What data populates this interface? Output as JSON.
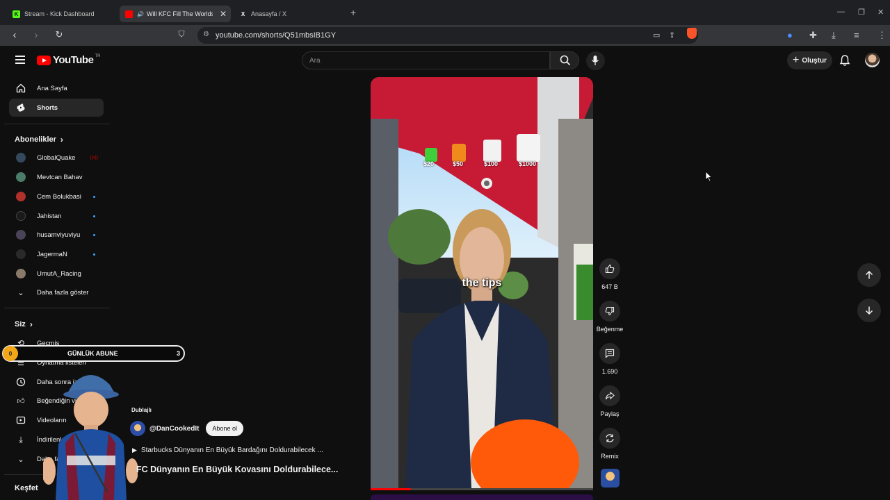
{
  "browser": {
    "tabs": [
      {
        "label": "Stream - Kick Dashboard",
        "active": false
      },
      {
        "label": "Will KFC Fill The Worlds Big",
        "active": true
      },
      {
        "label": "Anasayfa / X",
        "active": false
      }
    ],
    "url": "youtube.com/shorts/Q51mbsIB1GY",
    "colors": {
      "tabbar": "#1f2023",
      "toolbar": "#35363a",
      "kick": "#53fc18"
    }
  },
  "header": {
    "logo_text": "YouTube",
    "country_code": "TR",
    "search_placeholder": "Ara",
    "create_label": "Oluştur"
  },
  "sidebar": {
    "main": [
      {
        "label": "Ana Sayfa",
        "icon": "home-icon"
      },
      {
        "label": "Shorts",
        "icon": "shorts-icon",
        "active": true
      }
    ],
    "subscriptions_title": "Abonelikler",
    "subscriptions": [
      {
        "label": "GlobalQuake",
        "live": true
      },
      {
        "label": "Mevtcan Bahav",
        "new": false
      },
      {
        "label": "Cem Bolukbasi",
        "new": true
      },
      {
        "label": "Jahistan",
        "new": true
      },
      {
        "label": "husamviyuviyu",
        "new": true
      },
      {
        "label": "JagermaN",
        "new": true
      },
      {
        "label": "UmutA_Racing",
        "new": false
      }
    ],
    "show_more": "Daha fazla göster",
    "you_title": "Siz",
    "you_items": [
      {
        "label": "Geçmiş",
        "icon": "history-icon"
      },
      {
        "label": "Oynatma listeleri",
        "icon": "playlist-icon"
      },
      {
        "label": "Daha sonra izle",
        "icon": "clock-icon"
      },
      {
        "label": "Beğendiğin videolar",
        "icon": "like-icon"
      },
      {
        "label": "Videoların",
        "icon": "video-icon"
      },
      {
        "label": "İndirilenler",
        "icon": "download-icon"
      },
      {
        "label": "Daha fazla",
        "icon": "chevron-down-icon"
      }
    ],
    "explore_title": "Keşfet"
  },
  "overlay": {
    "sub_goal_title": "GÜNLÜK ABUNE",
    "sub_goal_start": "0",
    "sub_goal_count": "3"
  },
  "short": {
    "caption": "the tips",
    "prices": [
      "$20",
      "$50",
      "$100",
      "$1000"
    ],
    "dubbed_label": "Dublajlı",
    "channel": "@DanCookedIt",
    "subscribe_label": "Abone ol",
    "song": "Starbucks Dünyanın En Büyük Bardağını Doldurabilecek ...",
    "title": "FC Dünyanın En Büyük Kovasını Doldurabilece...",
    "progress": 0.18
  },
  "actions": {
    "likes": "647 B",
    "dislike_label": "Beğenme",
    "comments": "1.690",
    "share_label": "Paylaş",
    "remix_label": "Remix"
  }
}
